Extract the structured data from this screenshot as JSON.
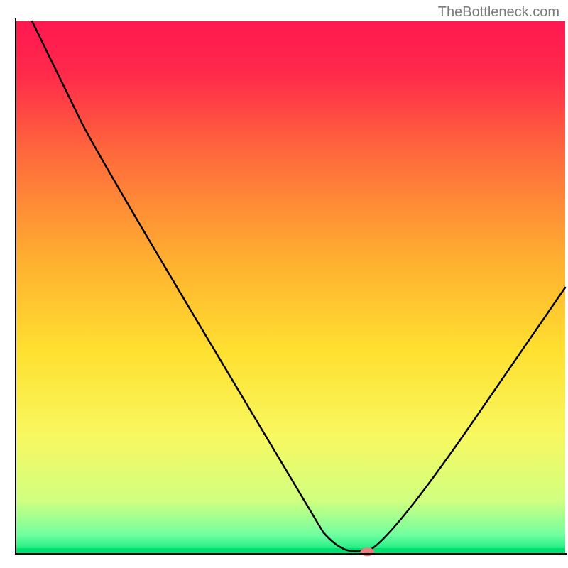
{
  "attribution": "TheBottleneck.com",
  "chart_data": {
    "type": "line",
    "title": "",
    "xlabel": "",
    "ylabel": "",
    "xlim": [
      0,
      100
    ],
    "ylim": [
      0,
      100
    ],
    "background": {
      "type": "vertical-gradient",
      "stops": [
        {
          "offset": 0.0,
          "color": "#ff1850"
        },
        {
          "offset": 0.1,
          "color": "#ff2a4a"
        },
        {
          "offset": 0.25,
          "color": "#ff6a3c"
        },
        {
          "offset": 0.45,
          "color": "#ffb030"
        },
        {
          "offset": 0.62,
          "color": "#ffe030"
        },
        {
          "offset": 0.78,
          "color": "#f8f860"
        },
        {
          "offset": 0.9,
          "color": "#d0ff80"
        },
        {
          "offset": 0.965,
          "color": "#70ffa0"
        },
        {
          "offset": 1.0,
          "color": "#00e878"
        }
      ]
    },
    "series": [
      {
        "name": "bottleneck-curve",
        "color": "#000000",
        "width": 2.5,
        "points": [
          {
            "x": 3,
            "y": 100
          },
          {
            "x": 12,
            "y": 81
          },
          {
            "x": 15.5,
            "y": 74
          },
          {
            "x": 56,
            "y": 4
          },
          {
            "x": 59,
            "y": 0.5
          },
          {
            "x": 64,
            "y": 0.5
          },
          {
            "x": 68,
            "y": 2
          },
          {
            "x": 100,
            "y": 50
          }
        ]
      }
    ],
    "marker": {
      "x": 64,
      "y": 0.5,
      "color": "#e88080",
      "rx": 10,
      "ry": 6
    },
    "axes": {
      "stroke": "#000000",
      "width": 2
    }
  }
}
